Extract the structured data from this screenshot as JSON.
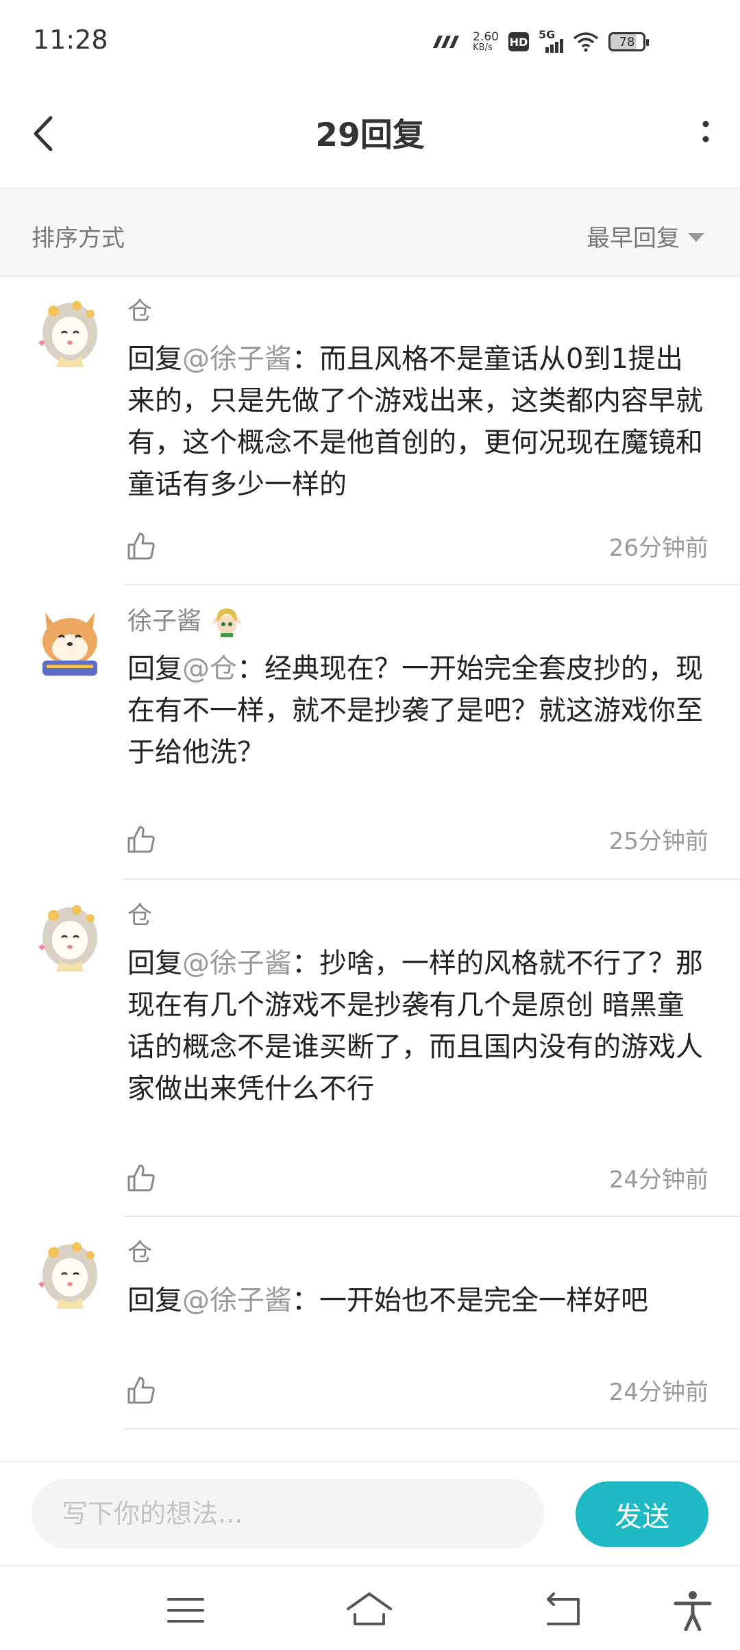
{
  "status_bar": {
    "time": "11:28",
    "net_speed_value": "2.60",
    "net_speed_unit": "KB/s",
    "hd_label": "HD",
    "network_label": "5G",
    "battery_level": "78"
  },
  "header": {
    "title": "29回复"
  },
  "sort": {
    "label": "排序方式",
    "selected": "最早回复"
  },
  "replies": [
    {
      "username": "仓",
      "prefix": "回复",
      "mention": "@徐子酱",
      "text": "：而且风格不是童话从0到1提出来的，只是先做了个游戏出来，这类都内容早就有，这个概念不是他首创的，更何况现在魔镜和童话有多少一样的",
      "time": "26分钟前",
      "avatar": "girl-avatar"
    },
    {
      "username": "徐子酱",
      "prefix": "回复",
      "mention": "@仓",
      "text": "：经典现在？一开始完全套皮抄的，现在有不一样，就不是抄袭了是吧？就这游戏你至于给他洗？",
      "time": "25分钟前",
      "avatar": "shiba-avatar",
      "badge": "link-badge"
    },
    {
      "username": "仓",
      "prefix": "回复",
      "mention": "@徐子酱",
      "text": "：抄啥，一样的风格就不行了？那现在有几个游戏不是抄袭有几个是原创 暗黑童话的概念不是谁买断了，而且国内没有的游戏人家做出来凭什么不行",
      "time": "24分钟前",
      "avatar": "girl-avatar"
    },
    {
      "username": "仓",
      "prefix": "回复",
      "mention": "@徐子酱",
      "text": "：一开始也不是完全一样好吧",
      "time": "24分钟前",
      "avatar": "girl-avatar"
    }
  ],
  "input": {
    "placeholder": "写下你的想法...",
    "send_label": "发送"
  },
  "colors": {
    "accent": "#1dbac4",
    "mention": "#999999",
    "text": "#222222"
  }
}
